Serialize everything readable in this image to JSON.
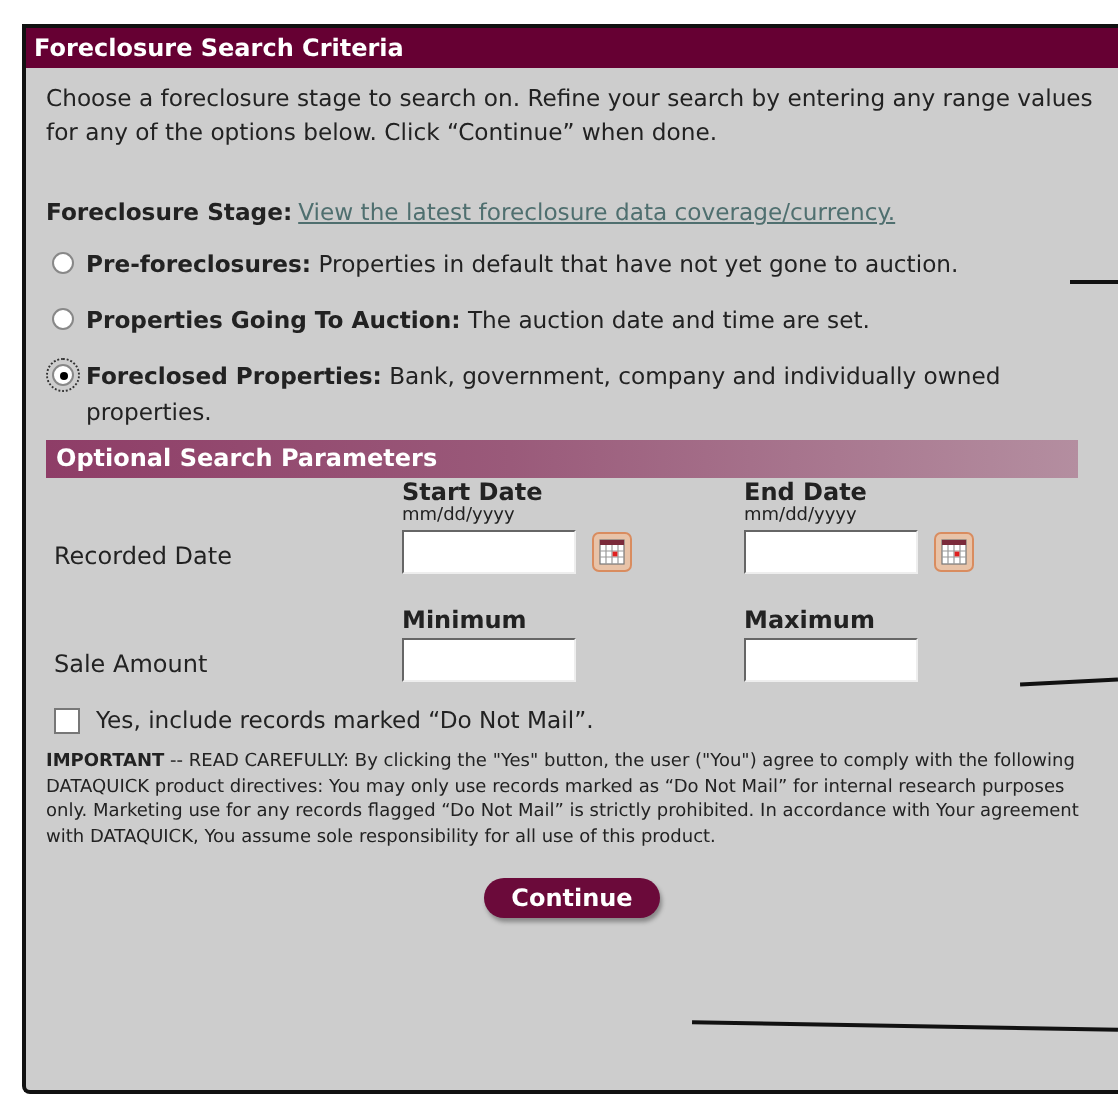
{
  "panel": {
    "title": "Foreclosure Search Criteria",
    "intro": "Choose a foreclosure stage to search on. Refine your search by entering any range values for any of the options below. Click “Continue” when done.",
    "stage_label": "Foreclosure Stage:",
    "stage_link": "View the latest foreclosure data coverage/currency.",
    "stages": [
      {
        "label": "Pre-foreclosures:",
        "description": "Properties in default that have not yet gone to auction.",
        "selected": false
      },
      {
        "label": "Properties Going To Auction:",
        "description": "The auction date and time are set.",
        "selected": false
      },
      {
        "label": "Foreclosed Properties:",
        "description": "Bank, government, company and individually owned properties.",
        "selected": true
      }
    ],
    "optional_title": "Optional Search Parameters",
    "parameters": [
      {
        "label": "Recorded Date",
        "kind": "date",
        "columns": [
          {
            "heading": "Start Date",
            "hint": "mm/dd/yyyy"
          },
          {
            "heading": "End Date",
            "hint": "mm/dd/yyyy"
          }
        ]
      },
      {
        "label": "Sale Amount",
        "kind": "amount",
        "columns": [
          {
            "heading": "Minimum"
          },
          {
            "heading": "Maximum"
          }
        ]
      }
    ],
    "do_not_mail": {
      "label": "Yes, include records marked “Do Not Mail”.",
      "checked": false
    },
    "notice": "**IMPORTANT** -- READ CAREFULLY: By clicking the \"Yes\" button, the user (\"You\") agree to comply with the following DATAQUICK product directives: You may only use records marked as “Do Not Mail” for internal research purposes only. Marketing use for any records flagged “Do Not Mail” is strictly prohibited. In accordance with Your agreement with DATAQUICK, You assume sole responsibility for all use of this product.",
    "button": "Continue"
  }
}
